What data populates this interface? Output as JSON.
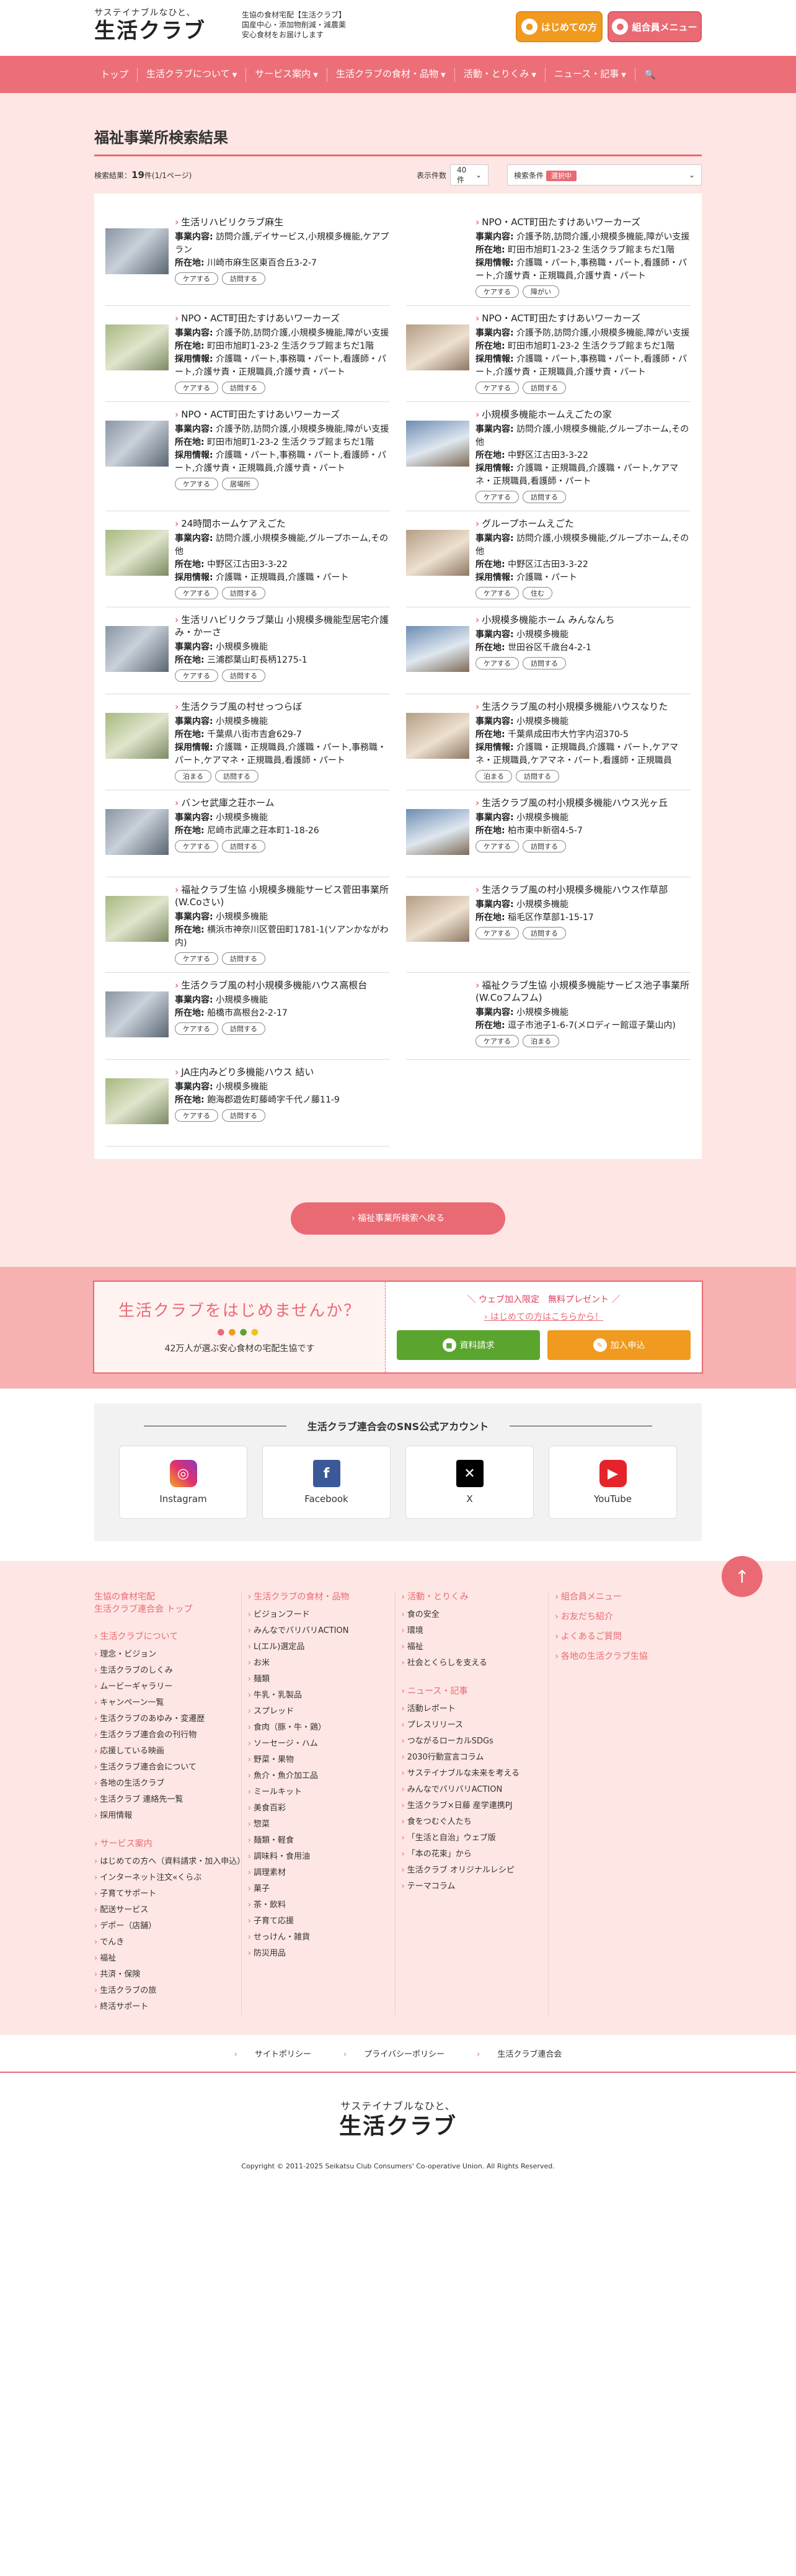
{
  "header": {
    "logo_sub": "サステイナブルなひと、",
    "logo_main": "生活クラブ",
    "tagline_1": "生協の食材宅配【生活クラブ】",
    "tagline_2": "国産中心・添加物削減・減農薬",
    "tagline_3": "安心食材をお届けします",
    "beginner_btn": "はじめての方",
    "member_btn": "組合員メニュー"
  },
  "nav": {
    "items": [
      "トップ",
      "生活クラブについて",
      "サービス案内",
      "生活クラブの食材・品物",
      "活動・とりくみ",
      "ニュース・記事"
    ],
    "search_icon": "search-icon"
  },
  "page": {
    "title": "福祉事業所検索結果",
    "result_label": "検索結果：",
    "result_count": "19",
    "result_unit": "件(1/1ページ)",
    "display_label": "表示件数",
    "display_value": "40件",
    "search_cond_label": "検索条件",
    "search_cond_tag": "選択中",
    "back_button": "福祉事業所検索へ戻る"
  },
  "labels": {
    "service": "事業内容:",
    "address": "所在地:",
    "recruit": "採用情報:"
  },
  "facilities": [
    {
      "name": "生活リハビリクラブ麻生",
      "service": "訪問介護,デイサービス,小規模多機能,ケアプラン",
      "address": "川崎市麻生区東百合丘3-2-7",
      "recruit": "",
      "tags": [
        "ケアする",
        "訪問する"
      ]
    },
    {
      "name": "NPO・ACT町田たすけあいワーカーズ",
      "service": "介護予防,訪問介護,小規模多機能,障がい支援",
      "address": "町田市旭町1-23-2 生活クラブ館まちだ1階",
      "recruit": "介護職・パート,事務職・パート,看護師・パート,介護サ責・正規職員,介護サ責・パート",
      "tags": [
        "ケアする",
        "障がい"
      ]
    },
    {
      "name": "NPO・ACT町田たすけあいワーカーズ",
      "service": "介護予防,訪問介護,小規模多機能,障がい支援",
      "address": "町田市旭町1-23-2 生活クラブ館まちだ1階",
      "recruit": "介護職・パート,事務職・パート,看護師・パート,介護サ責・正規職員,介護サ責・パート",
      "tags": [
        "ケアする",
        "訪問する"
      ]
    },
    {
      "name": "NPO・ACT町田たすけあいワーカーズ",
      "service": "介護予防,訪問介護,小規模多機能,障がい支援",
      "address": "町田市旭町1-23-2 生活クラブ館まちだ1階",
      "recruit": "介護職・パート,事務職・パート,看護師・パート,介護サ責・正規職員,介護サ責・パート",
      "tags": [
        "ケアする",
        "訪問する"
      ]
    },
    {
      "name": "NPO・ACT町田たすけあいワーカーズ",
      "service": "介護予防,訪問介護,小規模多機能,障がい支援",
      "address": "町田市旭町1-23-2 生活クラブ館まちだ1階",
      "recruit": "介護職・パート,事務職・パート,看護師・パート,介護サ責・正規職員,介護サ責・パート",
      "tags": [
        "ケアする",
        "居場所"
      ]
    },
    {
      "name": "小規模多機能ホームえごたの家",
      "service": "訪問介護,小規模多機能,グループホーム,その他",
      "address": "中野区江古田3-3-22",
      "recruit": "介護職・正規職員,介護職・パート,ケアマネ・正規職員,看護師・パート",
      "tags": [
        "ケアする",
        "訪問する"
      ]
    },
    {
      "name": "24時間ホームケアえごた",
      "service": "訪問介護,小規模多機能,グループホーム,その他",
      "address": "中野区江古田3-3-22",
      "recruit": "介護職・正規職員,介護職・パート",
      "tags": [
        "ケアする",
        "訪問する"
      ]
    },
    {
      "name": "グループホームえごた",
      "service": "訪問介護,小規模多機能,グループホーム,その他",
      "address": "中野区江古田3-3-22",
      "recruit": "介護職・パート",
      "tags": [
        "ケアする",
        "住む"
      ]
    },
    {
      "name": "生活リハビリクラブ葉山 小規模多機能型居宅介護み・かーさ",
      "service": "小規模多機能",
      "address": "三浦郡葉山町長柄1275-1",
      "recruit": "",
      "tags": [
        "ケアする",
        "訪問する"
      ]
    },
    {
      "name": "小規模多機能ホーム みんなんち",
      "service": "小規模多機能",
      "address": "世田谷区千歳台4-2-1",
      "recruit": "",
      "tags": [
        "ケアする",
        "訪問する"
      ]
    },
    {
      "name": "生活クラブ風の村せっつらぼ",
      "service": "小規模多機能",
      "address": "千葉県八街市吉倉629-7",
      "recruit": "介護職・正規職員,介護職・パート,事務職・パート,ケアマネ・正規職員,看護師・パート",
      "tags": [
        "泊まる",
        "訪問する"
      ]
    },
    {
      "name": "生活クラブ風の村小規模多機能ハウスなりた",
      "service": "小規模多機能",
      "address": "千葉県成田市大竹字内沼370-5",
      "recruit": "介護職・正規職員,介護職・パート,ケアマネ・正規職員,ケアマネ・パート,看護師・正規職員",
      "tags": [
        "泊まる",
        "訪問する"
      ]
    },
    {
      "name": "バンセ武庫之荘ホーム",
      "service": "小規模多機能",
      "address": "尼崎市武庫之荘本町1-18-26",
      "recruit": "",
      "tags": [
        "ケアする",
        "訪問する"
      ]
    },
    {
      "name": "生活クラブ風の村小規模多機能ハウス光ヶ丘",
      "service": "小規模多機能",
      "address": "柏市東中新宿4-5-7",
      "recruit": "",
      "tags": [
        "ケアする",
        "訪問する"
      ]
    },
    {
      "name": "福祉クラブ生協 小規模多機能サービス菅田事業所(W.Coさい)",
      "service": "小規模多機能",
      "address": "横浜市神奈川区菅田町1781-1(ソアンかながわ内)",
      "recruit": "",
      "tags": [
        "ケアする",
        "訪問する"
      ]
    },
    {
      "name": "生活クラブ風の村小規模多機能ハウス作草部",
      "service": "小規模多機能",
      "address": "稲毛区作草部1-15-17",
      "recruit": "",
      "tags": [
        "ケアする",
        "訪問する"
      ]
    },
    {
      "name": "生活クラブ風の村小規模多機能ハウス高根台",
      "service": "小規模多機能",
      "address": "船橋市高根台2-2-17",
      "recruit": "",
      "tags": [
        "ケアする",
        "訪問する"
      ]
    },
    {
      "name": "福祉クラブ生協 小規模多機能サービス池子事業所(W.Coフムフム)",
      "service": "小規模多機能",
      "address": "逗子市池子1-6-7(メロディー館逗子葉山内)",
      "recruit": "",
      "tags": [
        "ケアする",
        "泊まる"
      ]
    },
    {
      "name": "JA庄内みどり多機能ハウス 結い",
      "service": "小規模多機能",
      "address": "飽海郡遊佐町藤崎字千代ノ藤11-9",
      "recruit": "",
      "tags": [
        "ケアする",
        "訪問する"
      ]
    }
  ],
  "join": {
    "title": "生活クラブをはじめませんか？",
    "subtitle": "42万人が選ぶ安心食材の宅配生協です",
    "present": "＼ ウェブ加入限定　無料プレゼント ／",
    "beginner_link": "はじめての方はこちらから！",
    "request_btn": "資料請求",
    "join_btn": "加入申込"
  },
  "sns": {
    "title": "生活クラブ連合会のSNS公式アカウント",
    "items": [
      "Instagram",
      "Facebook",
      "X",
      "YouTube"
    ]
  },
  "footer": {
    "col1_top": "生協の食材宅配\n生活クラブ連合会 トップ",
    "col1_h1": "生活クラブについて",
    "col1_links1": [
      "理念・ビジョン",
      "生活クラブのしくみ",
      "ムービーギャラリー",
      "キャンペーン一覧",
      "生活クラブのあゆみ・変遷歴",
      "生活クラブ連合会の刊行物",
      "応援している映画",
      "生活クラブ連合会について",
      "各地の生活クラブ",
      "生活クラブ 連絡先一覧",
      "採用情報"
    ],
    "col1_h2": "サービス案内",
    "col1_links2": [
      "はじめての方へ（資料請求・加入申込）",
      "インターネット注文«くらぶ",
      "子育てサポート",
      "配送サービス",
      "デポー（店舗）",
      "でんき",
      "福祉",
      "共済・保険",
      "生活クラブの旅",
      "終活サポート"
    ],
    "col2_h": "生活クラブの食材・品物",
    "col2_links": [
      "ビジョンフード",
      "みんなでバリバリACTION",
      "L(エル)選定品",
      "お米",
      "麺類",
      "牛乳・乳製品",
      "スプレッド",
      "食肉（豚・牛・鶏）",
      "ソーセージ・ハム",
      "野菜・果物",
      "魚介・魚介加工品",
      "ミールキット",
      "美食百彩",
      "惣菜",
      "麺類・軽食",
      "調味料・食用油",
      "調理素材",
      "菓子",
      "茶・飲料",
      "子育て応援",
      "せっけん・雑貨",
      "防災用品"
    ],
    "col3_h1": "活動・とりくみ",
    "col3_links1": [
      "食の安全",
      "環境",
      "福祉",
      "社会とくらしを支える"
    ],
    "col3_h2": "ニュース・記事",
    "col3_links2": [
      "活動レポート",
      "プレスリリース",
      "つながるローカルSDGs",
      "2030行動宣言コラム",
      "サステイナブルな未来を考える",
      "みんなでバリバリACTION",
      "生活クラブ×日藤 産学連携PJ",
      "食をつむぐ人たち",
      "「生活と自治」ウェブ版",
      "「本の花束」から",
      "生活クラブ オリジナルレシピ",
      "テーマコラム"
    ],
    "col4_links": [
      "組合員メニュー",
      "お友だち紹介",
      "よくあるご質問",
      "各地の生活クラブ生協"
    ],
    "bottom_links": [
      "サイトポリシー",
      "プライバシーポリシー",
      "生活クラブ連合会"
    ],
    "logo_sub": "サステイナブルなひと、",
    "logo_main": "生活クラブ",
    "copyright": "Copyright © 2011-2025 Seikatsu Club Consumers' Co-operative Union. All Rights Reserved."
  },
  "colors": {
    "accent": "#ea6a74",
    "orange": "#f09a1f",
    "green": "#5aa52e",
    "bg_pink": "#fde6e3"
  }
}
